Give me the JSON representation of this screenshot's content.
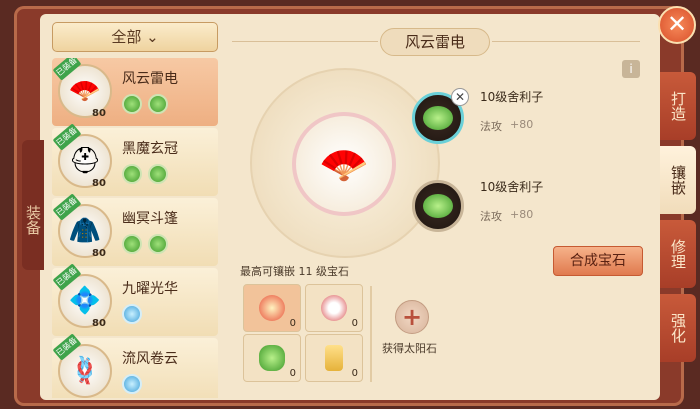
{
  "side_label": "装备",
  "filter": {
    "label": "全部",
    "icon": "chevron-down-icon"
  },
  "equipment_list": [
    {
      "name": "风云雷电",
      "level": "80",
      "ribbon": "已装备",
      "gems": [
        "green",
        "green"
      ],
      "icon": "fan-icon"
    },
    {
      "name": "黑魔玄冠",
      "level": "80",
      "ribbon": "已装备",
      "gems": [
        "green",
        "green"
      ],
      "icon": "helmet-icon"
    },
    {
      "name": "幽冥斗篷",
      "level": "80",
      "ribbon": "已装备",
      "gems": [
        "green",
        "green"
      ],
      "icon": "cloak-icon"
    },
    {
      "name": "九曜光华",
      "level": "80",
      "ribbon": "已装备",
      "gems": [
        "blue"
      ],
      "icon": "jewel-icon"
    },
    {
      "name": "流风卷云",
      "level": "",
      "ribbon": "已装备",
      "gems": [
        "blue"
      ],
      "icon": "belt-icon"
    }
  ],
  "panel_title": "风云雷电",
  "inlaid_gems": [
    {
      "name": "10级舍利子",
      "stat": "法攻",
      "value": "+80"
    },
    {
      "name": "10级舍利子",
      "stat": "法攻",
      "value": "+80"
    }
  ],
  "compose_button": "合成宝石",
  "max_label": "最高可镶嵌 11 级宝石",
  "inventory": [
    {
      "type": "red-orb",
      "count": "0",
      "color": "#e8503a"
    },
    {
      "type": "red-disc",
      "count": "0",
      "color": "#d84a4a"
    },
    {
      "type": "green-beans",
      "count": "0",
      "color": "#5cc23a"
    },
    {
      "type": "gold-token",
      "count": "0",
      "color": "#e6b23a"
    }
  ],
  "get_sun_stone": "获得太阳石",
  "right_tabs": [
    "打造",
    "镶嵌",
    "修理",
    "强化"
  ],
  "active_tab": "镶嵌"
}
